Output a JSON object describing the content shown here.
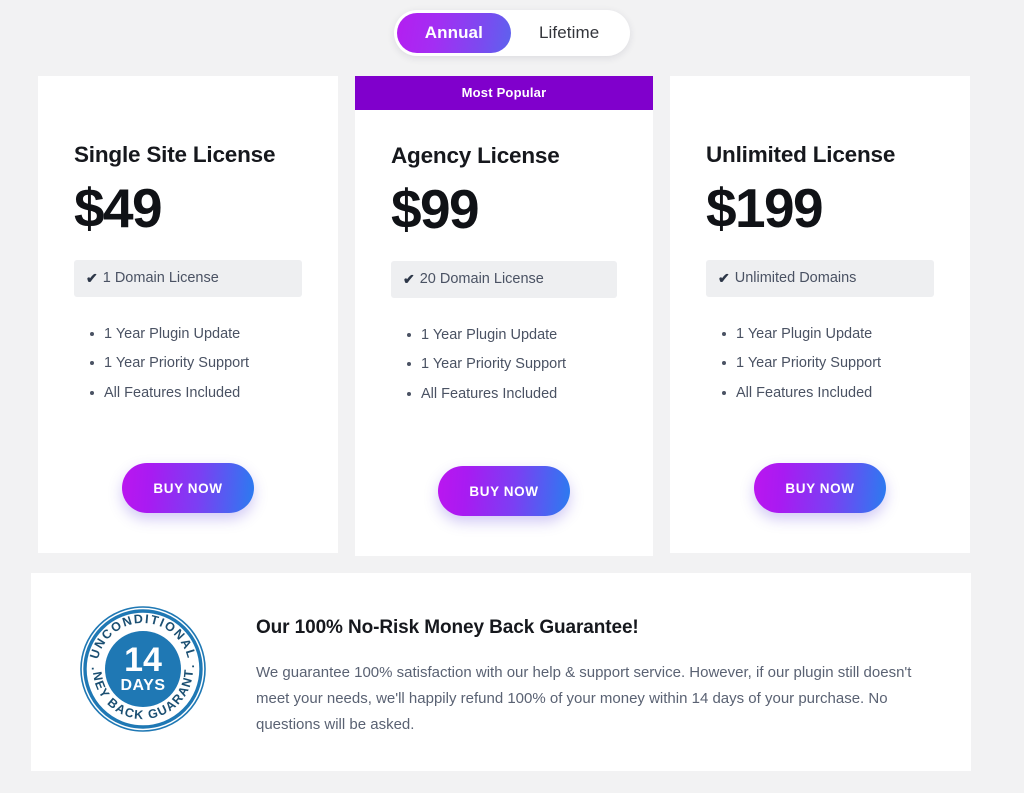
{
  "billing_toggle": {
    "options": [
      {
        "label": "Annual",
        "active": true
      },
      {
        "label": "Lifetime",
        "active": false
      }
    ],
    "active_color": "#a32ef3"
  },
  "ribbon": {
    "label": "Most Popular",
    "color": "#8000cc"
  },
  "plans": [
    {
      "name": "Single Site License",
      "price": "$49",
      "domain_badge": "1 Domain License",
      "features": [
        "1 Year Plugin Update",
        "1 Year Priority Support",
        "All Features Included"
      ],
      "cta": "BUY NOW",
      "featured": false
    },
    {
      "name": "Agency License",
      "price": "$99",
      "domain_badge": "20 Domain License",
      "features": [
        "1 Year Plugin Update",
        "1 Year Priority Support",
        "All Features Included"
      ],
      "cta": "BUY NOW",
      "featured": true
    },
    {
      "name": "Unlimited License",
      "price": "$199",
      "domain_badge": "Unlimited Domains",
      "features": [
        "1 Year Plugin Update",
        "1 Year Priority Support",
        "All Features Included"
      ],
      "cta": "BUY NOW",
      "featured": false
    }
  ],
  "guarantee": {
    "title": "Our 100% No-Risk Money Back Guarantee!",
    "body": "We guarantee 100% satisfaction with our help & support service. However, if our plugin still doesn't meet your needs, we'll happily refund 100% of your money within 14 days of your purchase. No questions will be asked.",
    "seal": {
      "top_text": "UNCONDITIONAL",
      "bottom_text": "MONEY BACK GUARANTEE",
      "number": "14",
      "unit": "DAYS",
      "color": "#1f78b4"
    }
  },
  "icons": {
    "check": "✔"
  }
}
